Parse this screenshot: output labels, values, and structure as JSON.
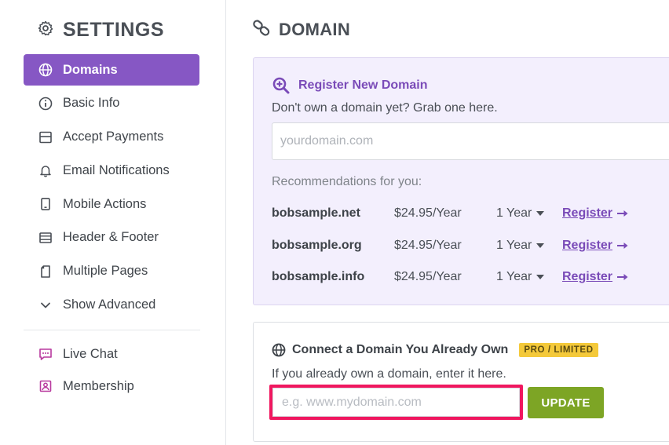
{
  "sidebar": {
    "title": "SETTINGS",
    "items": [
      {
        "label": "Domains",
        "icon": "globe-icon",
        "active": true
      },
      {
        "label": "Basic Info",
        "icon": "info-icon"
      },
      {
        "label": "Accept Payments",
        "icon": "credit-card-icon"
      },
      {
        "label": "Email Notifications",
        "icon": "bell-icon"
      },
      {
        "label": "Mobile Actions",
        "icon": "mobile-icon"
      },
      {
        "label": "Header & Footer",
        "icon": "header-footer-icon"
      },
      {
        "label": "Multiple Pages",
        "icon": "pages-icon"
      },
      {
        "label": "Show Advanced",
        "icon": "chevron-down-icon"
      }
    ],
    "extra_items": [
      {
        "label": "Live Chat",
        "icon": "chat-icon"
      },
      {
        "label": "Membership",
        "icon": "membership-icon"
      }
    ]
  },
  "main": {
    "title": "DOMAIN",
    "register": {
      "heading": "Register New Domain",
      "subtitle": "Don't own a domain yet? Grab one here.",
      "placeholder": "yourdomain.com",
      "recommend_label": "Recommendations for you:",
      "link_label": "Register",
      "rows": [
        {
          "name": "bobsample.net",
          "price": "$24.95/Year",
          "term": "1 Year"
        },
        {
          "name": "bobsample.org",
          "price": "$24.95/Year",
          "term": "1 Year"
        },
        {
          "name": "bobsample.info",
          "price": "$24.95/Year",
          "term": "1 Year"
        }
      ]
    },
    "connect": {
      "heading": "Connect a Domain You Already Own",
      "badge": "PRO / LIMITED",
      "subtitle": "If you already own a domain, enter it here.",
      "placeholder": "e.g. www.mydomain.com",
      "button": "UPDATE"
    }
  },
  "colors": {
    "accent": "#8657c4",
    "link": "#7a4bb8",
    "register_bg": "#f3effd",
    "update_button": "#7da525",
    "highlight": "#f0175f",
    "badge": "#f4c93a"
  }
}
